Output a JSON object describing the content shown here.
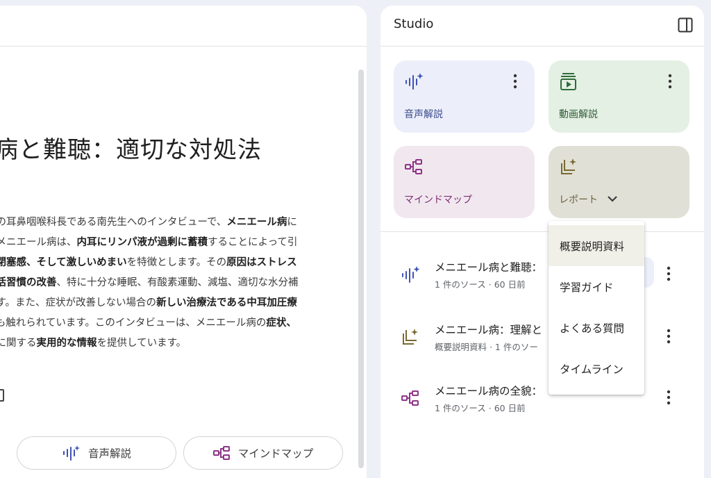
{
  "left": {
    "title": "病と難聴：適切な対処法",
    "summary_lines": [
      [
        {
          "t": "ーの耳鼻咽喉科長である南先生へのインタビューで、"
        },
        {
          "t": "メニエール病",
          "b": true
        },
        {
          "t": "に"
        }
      ],
      [
        {
          "t": "。メニエール病は、"
        },
        {
          "t": "内耳にリンパ液が過剰に蓄積",
          "b": true
        },
        {
          "t": "することによって引"
        }
      ],
      [
        {
          "t": "の閉塞感、そして激しいめまい",
          "b": true
        },
        {
          "t": "を特徴とします。その"
        },
        {
          "t": "原因はストレス",
          "b": true
        }
      ],
      [
        {
          "t": "生活習慣の改善",
          "b": true
        },
        {
          "t": "、特に十分な睡眠、有酸素運動、減塩、適切な水分補"
        }
      ],
      [
        {
          "t": "ます。また、症状が改善しない場合の"
        },
        {
          "t": "新しい治療法である中耳加圧療",
          "b": true
        }
      ],
      [
        {
          "t": "ても触れられています。このインタビューは、メニエール病の"
        },
        {
          "t": "症状、",
          "b": true
        }
      ],
      [
        {
          "t": "病に関する"
        },
        {
          "t": "実用的な情報",
          "b": true
        },
        {
          "t": "を提供しています。"
        }
      ]
    ],
    "buttons": {
      "audio": "音声解説",
      "mindmap": "マインドマップ"
    }
  },
  "studio": {
    "title": "Studio",
    "tiles": {
      "audio": "音声解説",
      "video": "動画解説",
      "mindmap": "マインドマップ",
      "report": "レポート"
    },
    "notes": [
      {
        "title": "メニエール病と難聴：",
        "sub": "1 件のソース · 60 日前"
      },
      {
        "title": "メニエール病：理解と",
        "sub": "概要説明資料 · 1 件のソー"
      },
      {
        "title": "メニエール病の全貌：",
        "sub": "1 件のソース · 60 日前"
      }
    ]
  },
  "dropdown": {
    "items": [
      "概要説明資料",
      "学習ガイド",
      "よくある質問",
      "タイムライン"
    ],
    "selected": "概要説明資料"
  },
  "colors": {
    "audio_icon": "#3f51b5",
    "video_icon": "#2e6b3a",
    "mindmap_icon": "#8e3487",
    "report_icon": "#7a6a30"
  }
}
